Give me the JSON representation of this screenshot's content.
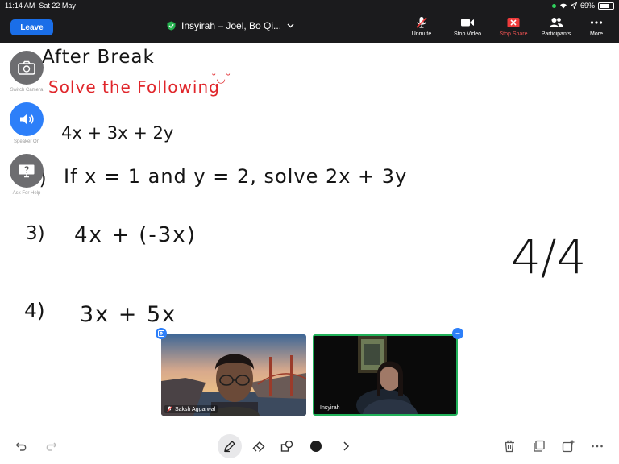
{
  "status_bar": {
    "time": "11:14 AM",
    "date": "Sat 22 May",
    "battery_percent": "69%",
    "battery_level": 0.69
  },
  "toolbar": {
    "leave_label": "Leave",
    "meeting_title": "Insyirah – Joel, Bo Qi...",
    "unmute_label": "Unmute",
    "stop_video_label": "Stop Video",
    "stop_share_label": "Stop Share",
    "participants_label": "Participants",
    "more_label": "More"
  },
  "side_controls": {
    "switch_camera_label": "Switch Camera",
    "speaker_label": "Speaker On",
    "help_label": "Ask For Help"
  },
  "whiteboard": {
    "heading": "After Break",
    "instruction": "Solve the Following",
    "smiley": "˘◡˘",
    "q1_expr": "4x + 3x + 2y",
    "q2_number": "2)",
    "q2_expr": "If x = 1 and y = 2,  solve  2x + 3y",
    "q3_number": "3)",
    "q3_expr": "4x + (-3x)",
    "q4_number": "4)",
    "q4_expr": "3x + 5x",
    "side_note": "4/4"
  },
  "participants": [
    {
      "name": "Saksh Aggarwal",
      "muted": true
    },
    {
      "name": "Insyirah",
      "muted": false
    }
  ],
  "colors": {
    "topbar": "#1b1b1d",
    "leave": "#1a6ee8",
    "speaker": "#2d7ff9",
    "red_ink": "#e0262b",
    "active_speaker_border": "#21b15a"
  }
}
